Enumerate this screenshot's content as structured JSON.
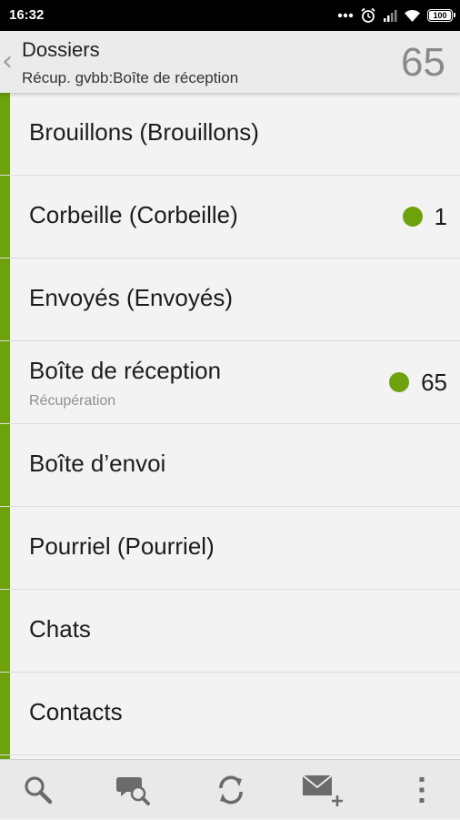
{
  "status_bar": {
    "time": "16:32",
    "battery_level": "100",
    "battery_fraction": 1.0,
    "icons": [
      "dots-icon",
      "alarm-icon",
      "signal-icon",
      "wifi-icon",
      "battery-icon"
    ]
  },
  "header": {
    "title": "Dossiers",
    "subtitle": "Récup. gvbb:Boîte de réception",
    "unread_total": "65",
    "back_icon": "chevron-left-icon"
  },
  "colors": {
    "accent": "#6ea20c",
    "row_background": "#f3f3f3",
    "header_background": "#ebebeb",
    "bottom_bar_background": "#e9e9e9"
  },
  "folders": [
    {
      "name": "Brouillons (Brouillons)",
      "sub": "",
      "unread": ""
    },
    {
      "name": "Corbeille (Corbeille)",
      "sub": "",
      "unread": "1"
    },
    {
      "name": "Envoyés (Envoyés)",
      "sub": "",
      "unread": ""
    },
    {
      "name": "Boîte de réception",
      "sub": "Récupération",
      "unread": "65"
    },
    {
      "name": "Boîte d’envoi",
      "sub": "",
      "unread": ""
    },
    {
      "name": "Pourriel (Pourriel)",
      "sub": "",
      "unread": ""
    },
    {
      "name": "Chats",
      "sub": "",
      "unread": ""
    },
    {
      "name": "Contacts",
      "sub": "",
      "unread": ""
    },
    {
      "name": "",
      "sub": "",
      "unread": ""
    }
  ],
  "bottom_bar": {
    "actions": [
      "search-icon",
      "search-messages-icon",
      "refresh-icon",
      "compose-icon",
      "overflow-menu-icon"
    ]
  }
}
